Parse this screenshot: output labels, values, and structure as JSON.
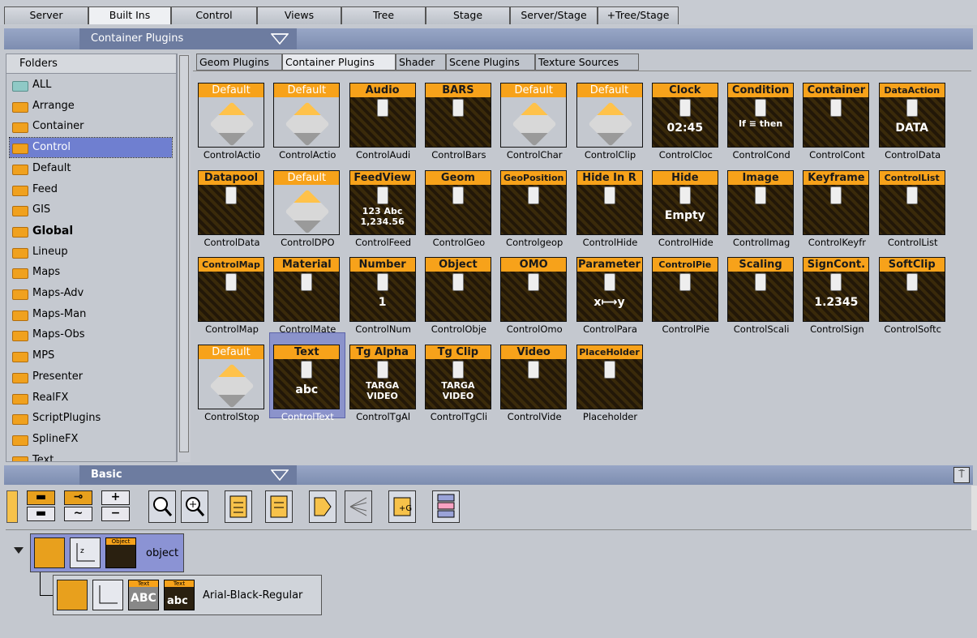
{
  "top_tabs": [
    "Server",
    "Built Ins",
    "Control",
    "Views",
    "Tree",
    "Stage",
    "Server/Stage",
    "+Tree/Stage"
  ],
  "top_tab_active": "Built Ins",
  "plugin_category": "Container Plugins",
  "folders": {
    "header": "Folders",
    "items": [
      "ALL",
      "Arrange",
      "Container",
      "Control",
      "Default",
      "Feed",
      "GIS",
      "Global",
      "Lineup",
      "Maps",
      "Maps-Adv",
      "Maps-Man",
      "Maps-Obs",
      "MPS",
      "Presenter",
      "RealFX",
      "ScriptPlugins",
      "SplineFX",
      "Text"
    ],
    "selected": "Control"
  },
  "plugin_tabs": [
    "Geom Plugins",
    "Container Plugins",
    "Shader",
    "Scene Plugins",
    "Texture Sources"
  ],
  "plugin_tab_active": "Container Plugins",
  "plugins": [
    {
      "label": "Default",
      "caption": "ControlActio"
    },
    {
      "label": "Default",
      "caption": "ControlActio"
    },
    {
      "label": "Audio",
      "caption": "ControlAudi"
    },
    {
      "label": "BARS",
      "caption": "ControlBars"
    },
    {
      "label": "Default",
      "caption": "ControlChar"
    },
    {
      "label": "Default",
      "caption": "ControlClip"
    },
    {
      "label": "Clock",
      "caption": "ControlCloc",
      "body": "02:45"
    },
    {
      "label": "Condition",
      "caption": "ControlCond",
      "body": "If ≡ then"
    },
    {
      "label": "Container",
      "caption": "ControlCont"
    },
    {
      "label": "DataAction",
      "caption": "ControlData",
      "body": "DATA"
    },
    {
      "label": "Datapool",
      "caption": "ControlData"
    },
    {
      "label": "Default",
      "caption": "ControlDPO"
    },
    {
      "label": "FeedView",
      "caption": "ControlFeed",
      "body": "123 Abc 1,234.56"
    },
    {
      "label": "Geom",
      "caption": "ControlGeo"
    },
    {
      "label": "GeoPosition",
      "caption": "Controlgeop"
    },
    {
      "label": "Hide In R",
      "caption": "ControlHide"
    },
    {
      "label": "Hide",
      "caption": "ControlHide",
      "body": "Empty"
    },
    {
      "label": "Image",
      "caption": "ControlImag"
    },
    {
      "label": "Keyframe",
      "caption": "ControlKeyfr"
    },
    {
      "label": "ControlList",
      "caption": "ControlList"
    },
    {
      "label": "ControlMap",
      "caption": "ControlMap"
    },
    {
      "label": "Material",
      "caption": "ControlMate"
    },
    {
      "label": "Number",
      "caption": "ControlNum",
      "body": "1"
    },
    {
      "label": "Object",
      "caption": "ControlObje"
    },
    {
      "label": "OMO",
      "caption": "ControlOmo"
    },
    {
      "label": "Parameter",
      "caption": "ControlPara",
      "body": "x⟼y"
    },
    {
      "label": "ControlPie",
      "caption": "ControlPie"
    },
    {
      "label": "Scaling",
      "caption": "ControlScali"
    },
    {
      "label": "SignCont.",
      "caption": "ControlSign",
      "body": "1.2345"
    },
    {
      "label": "SoftClip",
      "caption": "ControlSoftc"
    },
    {
      "label": "Default",
      "caption": "ControlStop"
    },
    {
      "label": "Text",
      "caption": "ControlText",
      "body": "abc"
    },
    {
      "label": "Tg Alpha",
      "caption": "ControlTgAl",
      "body": "TARGA VIDEO"
    },
    {
      "label": "Tg Clip",
      "caption": "ControlTgCli",
      "body": "TARGA VIDEO"
    },
    {
      "label": "Video",
      "caption": "ControlVide"
    },
    {
      "label": "PlaceHolder",
      "caption": "Placeholder"
    }
  ],
  "selected_plugin": "ControlText",
  "basic_title": "Basic",
  "tree": {
    "node1": {
      "label": "object",
      "badge": "Object"
    },
    "node2": {
      "label": "Arial-Black-Regular",
      "badge1": "Text",
      "badge2": "Text",
      "abc": "ABC",
      "abc2": "abc"
    }
  },
  "colors": {
    "accent": "#f7a21a",
    "selection": "#6f7fd0",
    "header": "#7d8db0"
  }
}
